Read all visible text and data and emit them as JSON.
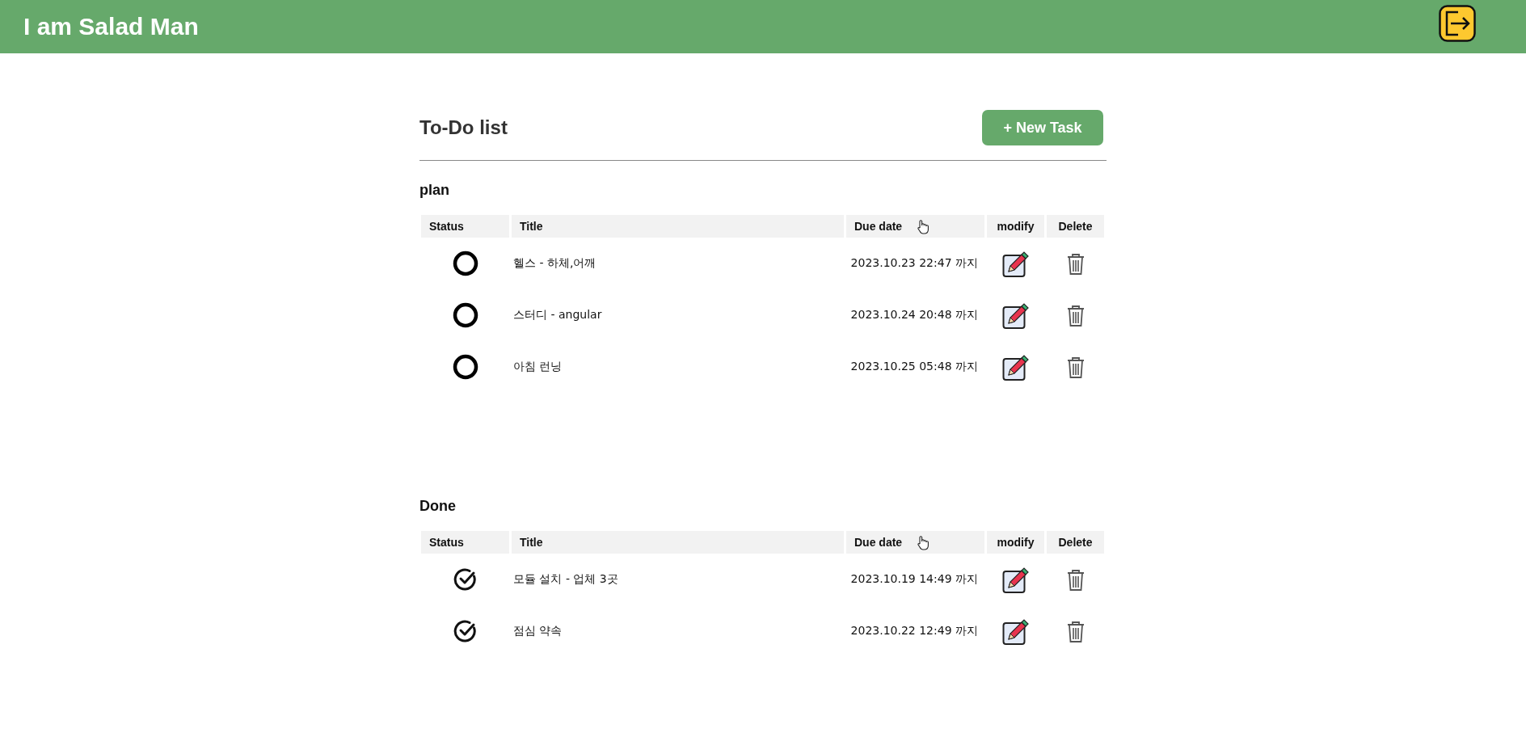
{
  "header": {
    "title": "I am Salad Man"
  },
  "page": {
    "title": "To-Do list",
    "new_task_button": "+ New Task"
  },
  "sections": [
    {
      "name": "plan",
      "columns": [
        "Status",
        "Title",
        "Due date",
        "modify",
        "Delete"
      ],
      "rows": [
        {
          "done": false,
          "title": "헬스 - 하체,어깨",
          "due": "2023.10.23 22:47 까지"
        },
        {
          "done": false,
          "title": "스터디 - angular",
          "due": "2023.10.24 20:48 까지"
        },
        {
          "done": false,
          "title": "아침 런닝",
          "due": "2023.10.25 05:48 까지"
        }
      ]
    },
    {
      "name": "Done",
      "columns": [
        "Status",
        "Title",
        "Due date",
        "modify",
        "Delete"
      ],
      "rows": [
        {
          "done": true,
          "title": "모듈 설치 - 업체 3곳",
          "due": "2023.10.19 14:49 까지"
        },
        {
          "done": true,
          "title": "점심 약속",
          "due": "2023.10.22 12:49 까지"
        }
      ]
    }
  ]
}
